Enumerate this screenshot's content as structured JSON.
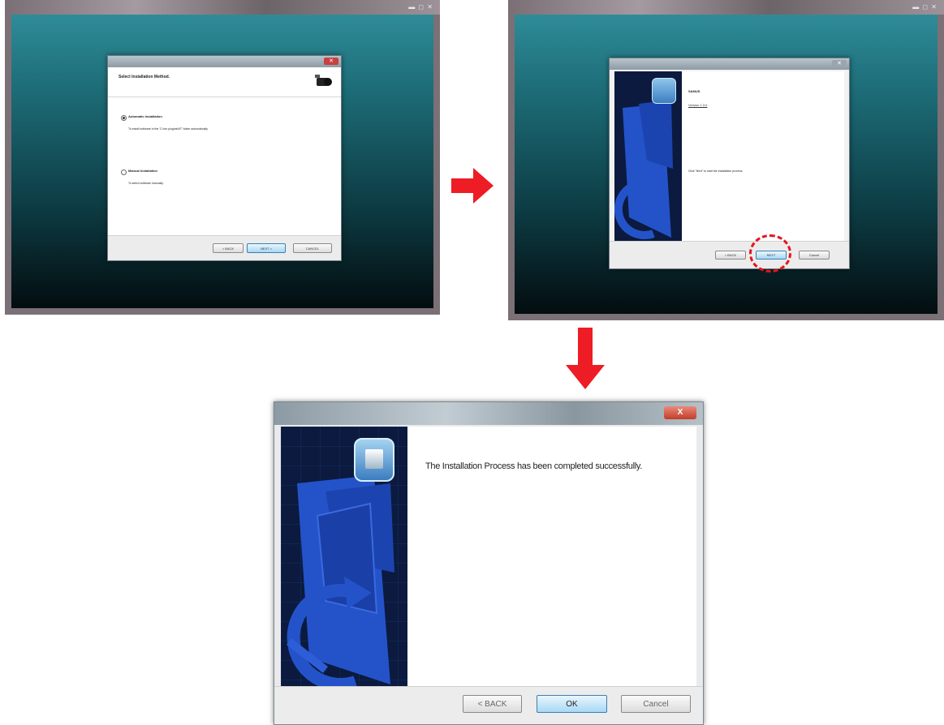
{
  "step1": {
    "heading": "Select Installation Method.",
    "option_auto_label": "Automatic Installation",
    "option_auto_desc": "To install software in the 'C:\\dvr plugins\\NT' folder automatically.",
    "option_manual_label": "Manual Installation",
    "option_manual_desc": "To select software manually.",
    "selected_option": "Automatic Installation",
    "back_label": "< BACK",
    "next_label": "NEXT >",
    "cancel_label": "CANCEL"
  },
  "step2": {
    "app_name": "SAMUS",
    "version_link": "Version 1.3.0",
    "instruction": "Click \"Next\" to start the installation process.",
    "back_label": "< BACK",
    "next_label": "NEXT",
    "cancel_label": "Cancel"
  },
  "step3": {
    "close_label": "X",
    "message": "The Installation Process has been completed successfully.",
    "back_label": "< BACK",
    "ok_label": "OK",
    "cancel_label": "Cancel"
  },
  "colors": {
    "arrow": "#ee1c24",
    "highlight_circle": "#e5141d",
    "banner_bg": "#0b1a3e",
    "banner_art": "#2453c9",
    "desktop_top": "#2e8c98",
    "desktop_bottom": "#030d10"
  },
  "icons": {
    "step_arrow": "arrow-right-icon",
    "step_arrow_down": "arrow-down-icon",
    "installer_logo": "installer-box-icon",
    "camera": "camera-icon"
  }
}
